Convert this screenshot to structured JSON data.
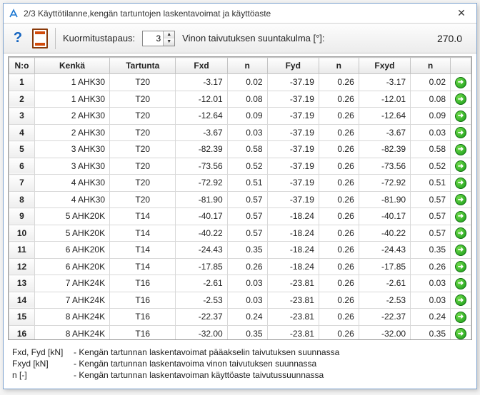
{
  "window": {
    "title": "2/3 Käyttötilanne,kengän tartuntojen laskentavoimat ja käyttöaste"
  },
  "toolbar": {
    "load_case_label": "Kuormitustapaus:",
    "load_case_value": "3",
    "angle_label": "Vinon taivutuksen suuntakulma [°]:",
    "angle_value": "270.0"
  },
  "columns": [
    "N:o",
    "Kenkä",
    "Tartunta",
    "Fxd",
    "n",
    "Fyd",
    "n",
    "Fxyd",
    "n",
    ""
  ],
  "rows": [
    {
      "n": "1",
      "kenka": "1 AHK30",
      "tartunta": "T20",
      "fxd": "-3.17",
      "n1": "0.02",
      "fyd": "-37.19",
      "n2": "0.26",
      "fxyd": "-3.17",
      "n3": "0.02"
    },
    {
      "n": "2",
      "kenka": "1 AHK30",
      "tartunta": "T20",
      "fxd": "-12.01",
      "n1": "0.08",
      "fyd": "-37.19",
      "n2": "0.26",
      "fxyd": "-12.01",
      "n3": "0.08"
    },
    {
      "n": "3",
      "kenka": "2 AHK30",
      "tartunta": "T20",
      "fxd": "-12.64",
      "n1": "0.09",
      "fyd": "-37.19",
      "n2": "0.26",
      "fxyd": "-12.64",
      "n3": "0.09"
    },
    {
      "n": "4",
      "kenka": "2 AHK30",
      "tartunta": "T20",
      "fxd": "-3.67",
      "n1": "0.03",
      "fyd": "-37.19",
      "n2": "0.26",
      "fxyd": "-3.67",
      "n3": "0.03"
    },
    {
      "n": "5",
      "kenka": "3 AHK30",
      "tartunta": "T20",
      "fxd": "-82.39",
      "n1": "0.58",
      "fyd": "-37.19",
      "n2": "0.26",
      "fxyd": "-82.39",
      "n3": "0.58"
    },
    {
      "n": "6",
      "kenka": "3 AHK30",
      "tartunta": "T20",
      "fxd": "-73.56",
      "n1": "0.52",
      "fyd": "-37.19",
      "n2": "0.26",
      "fxyd": "-73.56",
      "n3": "0.52"
    },
    {
      "n": "7",
      "kenka": "4 AHK30",
      "tartunta": "T20",
      "fxd": "-72.92",
      "n1": "0.51",
      "fyd": "-37.19",
      "n2": "0.26",
      "fxyd": "-72.92",
      "n3": "0.51"
    },
    {
      "n": "8",
      "kenka": "4 AHK30",
      "tartunta": "T20",
      "fxd": "-81.90",
      "n1": "0.57",
      "fyd": "-37.19",
      "n2": "0.26",
      "fxyd": "-81.90",
      "n3": "0.57"
    },
    {
      "n": "9",
      "kenka": "5 AHK20K",
      "tartunta": "T14",
      "fxd": "-40.17",
      "n1": "0.57",
      "fyd": "-18.24",
      "n2": "0.26",
      "fxyd": "-40.17",
      "n3": "0.57"
    },
    {
      "n": "10",
      "kenka": "5 AHK20K",
      "tartunta": "T14",
      "fxd": "-40.22",
      "n1": "0.57",
      "fyd": "-18.24",
      "n2": "0.26",
      "fxyd": "-40.22",
      "n3": "0.57"
    },
    {
      "n": "11",
      "kenka": "6 AHK20K",
      "tartunta": "T14",
      "fxd": "-24.43",
      "n1": "0.35",
      "fyd": "-18.24",
      "n2": "0.26",
      "fxyd": "-24.43",
      "n3": "0.35"
    },
    {
      "n": "12",
      "kenka": "6 AHK20K",
      "tartunta": "T14",
      "fxd": "-17.85",
      "n1": "0.26",
      "fyd": "-18.24",
      "n2": "0.26",
      "fxyd": "-17.85",
      "n3": "0.26"
    },
    {
      "n": "13",
      "kenka": "7 AHK24K",
      "tartunta": "T16",
      "fxd": "-2.61",
      "n1": "0.03",
      "fyd": "-23.81",
      "n2": "0.26",
      "fxyd": "-2.61",
      "n3": "0.03"
    },
    {
      "n": "14",
      "kenka": "7 AHK24K",
      "tartunta": "T16",
      "fxd": "-2.53",
      "n1": "0.03",
      "fyd": "-23.81",
      "n2": "0.26",
      "fxyd": "-2.53",
      "n3": "0.03"
    },
    {
      "n": "15",
      "kenka": "8 AHK24K",
      "tartunta": "T16",
      "fxd": "-22.37",
      "n1": "0.24",
      "fyd": "-23.81",
      "n2": "0.26",
      "fxyd": "-22.37",
      "n3": "0.24"
    },
    {
      "n": "16",
      "kenka": "8 AHK24K",
      "tartunta": "T16",
      "fxd": "-32.00",
      "n1": "0.35",
      "fyd": "-23.81",
      "n2": "0.26",
      "fxyd": "-32.00",
      "n3": "0.35"
    }
  ],
  "legend": {
    "l1_key": "Fxd, Fyd [kN]",
    "l1_txt": "- Kengän tartunnan laskentavoimat pääakselin taivutuksen suunnassa",
    "l2_key": "Fxyd [kN]",
    "l2_txt": "- Kengän tartunnan laskentavoima vinon taivutuksen suunnassa",
    "l3_key": "n [-]",
    "l3_txt": "- Kengän tartunnan laskentavoiman käyttöaste taivutussuunnassa"
  }
}
